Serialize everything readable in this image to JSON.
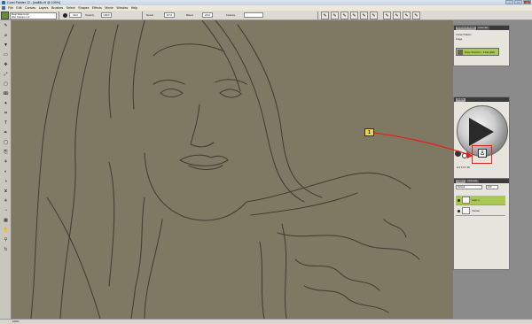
{
  "window": {
    "title": "Corel Painter 12 - [wall8c.rif @ 100%]",
    "controls": [
      "–",
      "□",
      "×"
    ]
  },
  "menubar": {
    "items": [
      "File",
      "Edit",
      "Canvas",
      "Layers",
      "Brushes",
      "Select",
      "Shapes",
      "Effects",
      "Movie",
      "Window",
      "Help"
    ]
  },
  "propbar": {
    "brush_category": "Real Watercolor",
    "brush_variant": "Wet Opaque 2.2",
    "size_value": "30.0",
    "opacity_label": "Opacity",
    "opacity_value": "100%",
    "resat_label": "Resat",
    "resat_value": "67%",
    "bleed_label": "Bleed",
    "bleed_value": "20%",
    "feature_label": "Feature"
  },
  "toolbox": {
    "tools": [
      {
        "name": "brush-tool",
        "glyph": "✎"
      },
      {
        "name": "dropper-tool",
        "glyph": "⌀"
      },
      {
        "name": "paint-bucket-tool",
        "glyph": "▼"
      },
      {
        "name": "eraser-tool",
        "glyph": "▭"
      },
      {
        "name": "layer-adjuster-tool",
        "glyph": "✥"
      },
      {
        "name": "transform-tool",
        "glyph": "⤢"
      },
      {
        "name": "rectangular-selection-tool",
        "glyph": "▢"
      },
      {
        "name": "lasso-tool",
        "glyph": "ↂ"
      },
      {
        "name": "magic-wand-tool",
        "glyph": "✦"
      },
      {
        "name": "crop-tool",
        "glyph": "⌗"
      },
      {
        "name": "text-tool",
        "glyph": "T"
      },
      {
        "name": "pen-tool",
        "glyph": "✒"
      },
      {
        "name": "shape-tool",
        "glyph": "◯"
      },
      {
        "name": "cloner-tool",
        "glyph": "⎘"
      },
      {
        "name": "rubber-stamp-tool",
        "glyph": "⚘"
      },
      {
        "name": "dodge-tool",
        "glyph": "◐"
      },
      {
        "name": "burn-tool",
        "glyph": "◑"
      },
      {
        "name": "mirror-tool",
        "glyph": "⧖"
      },
      {
        "name": "kaleidoscope-tool",
        "glyph": "✳"
      },
      {
        "name": "divine-proportion-tool",
        "glyph": "◔"
      },
      {
        "name": "perspective-grid-tool",
        "glyph": "▦"
      },
      {
        "name": "grabber-tool",
        "glyph": "✋"
      },
      {
        "name": "magnifier-tool",
        "glyph": "⚲"
      },
      {
        "name": "rotate-page-tool",
        "glyph": "↻"
      }
    ]
  },
  "reference_panel": {
    "tabs": [
      "Reference Image",
      "Color Set"
    ],
    "options": [
      "Current Pattern",
      "Image"
    ],
    "item_label": "Dune Scorpion - Final (Ref)"
  },
  "color_panel": {
    "tabs": [
      "Colors"
    ],
    "hsv_readout": "H 0 S 0 V 48"
  },
  "layers_panel": {
    "tabs": [
      "Layers",
      "Channels"
    ],
    "composite_method": "Default",
    "opacity": "100",
    "layers": [
      {
        "name": "Layer 1",
        "selected": true
      },
      {
        "name": "Canvas",
        "selected": false
      }
    ]
  },
  "callout": {
    "number": "1"
  },
  "status": {
    "zoom": "100%"
  }
}
